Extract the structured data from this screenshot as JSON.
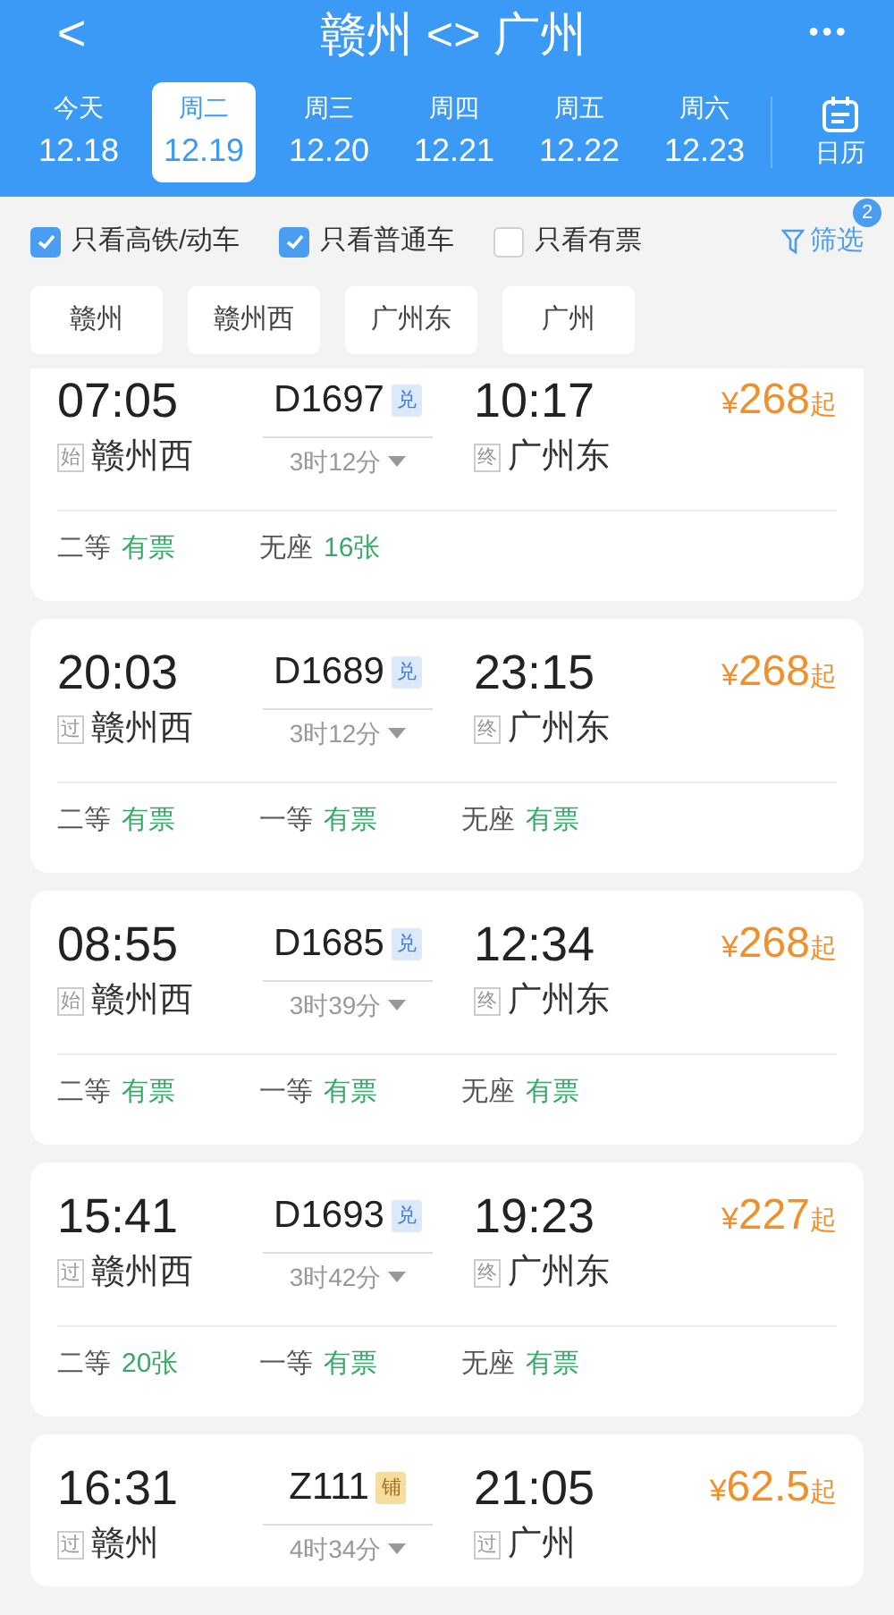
{
  "header": {
    "back": "<",
    "title": "赣州 <> 广州",
    "more": "•••"
  },
  "dates": [
    {
      "weekday": "今天",
      "date": "12.18",
      "selected": false
    },
    {
      "weekday": "周二",
      "date": "12.19",
      "selected": true
    },
    {
      "weekday": "周三",
      "date": "12.20",
      "selected": false
    },
    {
      "weekday": "周四",
      "date": "12.21",
      "selected": false
    },
    {
      "weekday": "周五",
      "date": "12.22",
      "selected": false
    },
    {
      "weekday": "周六",
      "date": "12.23",
      "selected": false
    }
  ],
  "calendar": {
    "label": "日历"
  },
  "filters": [
    {
      "label": "只看高铁/动车",
      "checked": true
    },
    {
      "label": "只看普通车",
      "checked": true
    },
    {
      "label": "只看有票",
      "checked": false
    }
  ],
  "screen": {
    "label": "筛选",
    "count": "2"
  },
  "stations": [
    "赣州",
    "赣州西",
    "广州东",
    "广州"
  ],
  "trains": [
    {
      "depart": "07:05",
      "train": "D1697",
      "badge": {
        "text": "兑",
        "kind": "exchange"
      },
      "arrive": "10:17",
      "price": "¥268",
      "price_suffix": "起",
      "from_tag": "始",
      "from": "赣州西",
      "duration": "3时12分",
      "to_tag": "终",
      "to": "广州东",
      "seats": [
        {
          "class": "二等",
          "status": "有票"
        },
        {
          "class": "无座",
          "status": "16张"
        }
      ]
    },
    {
      "depart": "20:03",
      "train": "D1689",
      "badge": {
        "text": "兑",
        "kind": "exchange"
      },
      "arrive": "23:15",
      "price": "¥268",
      "price_suffix": "起",
      "from_tag": "过",
      "from": "赣州西",
      "duration": "3时12分",
      "to_tag": "终",
      "to": "广州东",
      "seats": [
        {
          "class": "二等",
          "status": "有票"
        },
        {
          "class": "一等",
          "status": "有票"
        },
        {
          "class": "无座",
          "status": "有票"
        }
      ]
    },
    {
      "depart": "08:55",
      "train": "D1685",
      "badge": {
        "text": "兑",
        "kind": "exchange"
      },
      "arrive": "12:34",
      "price": "¥268",
      "price_suffix": "起",
      "from_tag": "始",
      "from": "赣州西",
      "duration": "3时39分",
      "to_tag": "终",
      "to": "广州东",
      "seats": [
        {
          "class": "二等",
          "status": "有票"
        },
        {
          "class": "一等",
          "status": "有票"
        },
        {
          "class": "无座",
          "status": "有票"
        }
      ]
    },
    {
      "depart": "15:41",
      "train": "D1693",
      "badge": {
        "text": "兑",
        "kind": "exchange"
      },
      "arrive": "19:23",
      "price": "¥227",
      "price_suffix": "起",
      "from_tag": "过",
      "from": "赣州西",
      "duration": "3时42分",
      "to_tag": "终",
      "to": "广州东",
      "seats": [
        {
          "class": "二等",
          "status": "20张"
        },
        {
          "class": "一等",
          "status": "有票"
        },
        {
          "class": "无座",
          "status": "有票"
        }
      ]
    },
    {
      "depart": "16:31",
      "train": "Z111",
      "badge": {
        "text": "铺",
        "kind": "sleeper"
      },
      "arrive": "21:05",
      "price": "¥62.5",
      "price_suffix": "起",
      "from_tag": "过",
      "from": "赣州",
      "duration": "4时34分",
      "to_tag": "过",
      "to": "广州"
    }
  ]
}
